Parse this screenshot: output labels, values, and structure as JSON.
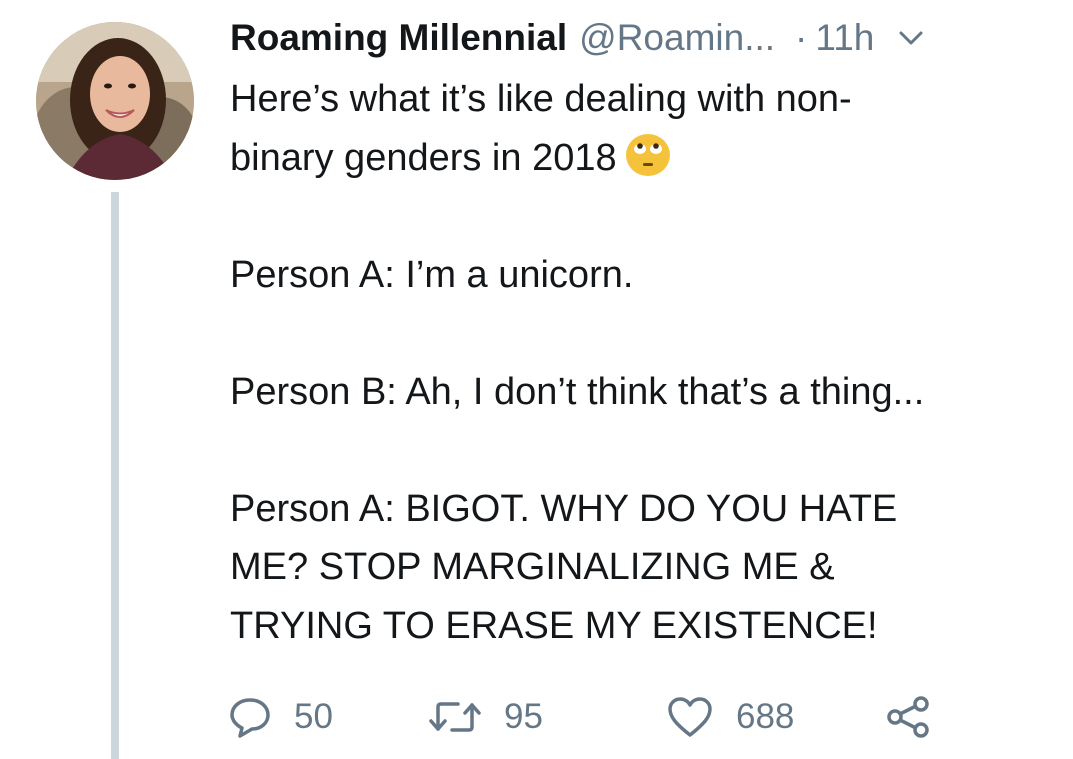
{
  "tweet": {
    "display_name": "Roaming Millennial",
    "handle": "@Roamin...",
    "separator": "·",
    "time": "11h",
    "lines": [
      "Here’s what it’s like dealing with non-",
      "binary genders in 2018",
      "",
      "Person A: I’m a unicorn.",
      "",
      "Person B: Ah, I don’t think that’s a thing...",
      "",
      "Person A: BIGOT. WHY DO YOU HATE",
      "ME? STOP MARGINALIZING ME &",
      "TRYING TO ERASE MY EXISTENCE!"
    ],
    "emoji": "face-with-rolling-eyes-emoji"
  },
  "actions": {
    "replies": "50",
    "retweets": "95",
    "likes": "688"
  },
  "icons": {
    "reply": "reply-icon",
    "retweet": "retweet-icon",
    "like": "heart-icon",
    "share": "share-icon",
    "menu": "chevron-down-icon"
  },
  "colors": {
    "text": "#14171a",
    "secondary": "#657786",
    "thread_line": "#ccd6dd",
    "emoji_face": "#f5c33b"
  }
}
